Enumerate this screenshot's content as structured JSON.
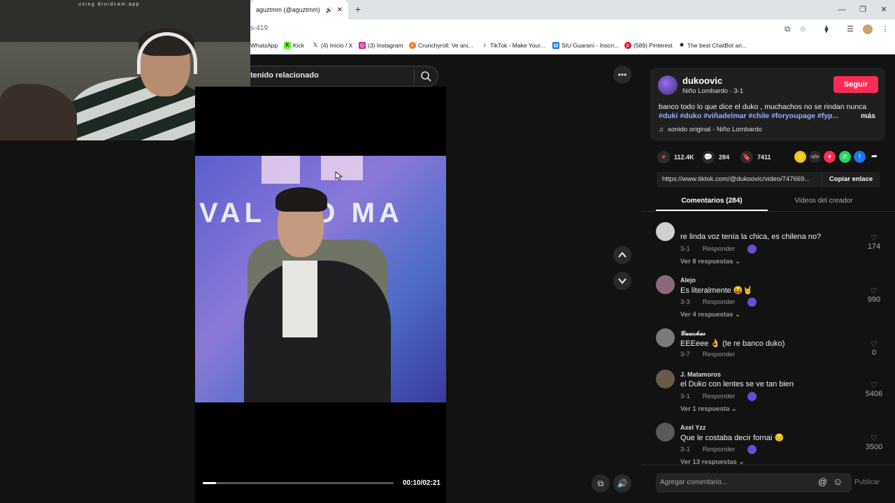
{
  "browser": {
    "tab_title": "aguztmm (@aguztmm) | Ti",
    "address": "s-419",
    "bookmarks": [
      {
        "label": "WhatsApp",
        "icon": "whatsapp-icon"
      },
      {
        "label": "Kick",
        "icon": "kick-icon"
      },
      {
        "label": "(4) Inicio / X",
        "icon": "x-icon"
      },
      {
        "label": "(3) Instagram",
        "icon": "instagram-icon"
      },
      {
        "label": "Crunchyroll: Ve ani...",
        "icon": "crunchyroll-icon"
      },
      {
        "label": "TikTok - Make Your...",
        "icon": "tiktok-icon"
      },
      {
        "label": "SIU Guaraní - Inscri...",
        "icon": "siu-icon"
      },
      {
        "label": "(589) Pinterest",
        "icon": "pinterest-icon"
      },
      {
        "label": "The best ChatBot an...",
        "icon": "chatgpt-icon"
      }
    ]
  },
  "webcam": {
    "label": "using droidcam.app"
  },
  "video": {
    "search_text": "tenido relacionado",
    "stage_text": "VAL    INO MA",
    "time": "00:10/02:21",
    "progress": 0.07
  },
  "creator": {
    "name": "dukoovic",
    "subtitle": "Niño Lombardo · 3-1",
    "follow_label": "Seguir",
    "description": "banco todo lo que dice el duko , muchachos no se rindan nunca",
    "tags": "#duki #duko #viñadelmar #chile #foryoupage #fyp...",
    "more_label": "más",
    "sound": "sonido original - Niño Lombardo"
  },
  "stats": {
    "likes": "112.4K",
    "comments": "284",
    "saves": "7411"
  },
  "link": {
    "url": "https://www.tiktok.com/@dukoovic/video/747669...",
    "copy_label": "Copiar enlace"
  },
  "tabs": {
    "comments": "Comentarios (284)",
    "creator_videos": "Videos del creador"
  },
  "comments": [
    {
      "user": "",
      "text": "re linda voz tenía la chica, es chilena no?",
      "date": "3-1",
      "reply": "Responder",
      "replies": "Ver 8 respuestas ⌄",
      "likes": "174",
      "avatar": "#cfcfcf"
    },
    {
      "user": "Alejo",
      "text": "Es literalmente 😝🤘",
      "date": "3-3",
      "reply": "Responder",
      "replies": "Ver 4 respuestas ⌄",
      "likes": "990",
      "avatar": "#8a6a7a"
    },
    {
      "user": "𝓖𝓾𝓪𝓬𝓱𝓪𝓼",
      "text": "EEEeee 👌 (te re banco duko)",
      "date": "3-7",
      "reply": "Responder",
      "replies": "",
      "likes": "0",
      "avatar": "#7a7a7a"
    },
    {
      "user": "J. Matamoros",
      "text": "el Duko con lentes se ve tan bien",
      "date": "3-1",
      "reply": "Responder",
      "replies": "Ver 1 respuesta ⌄",
      "likes": "5406",
      "avatar": "#6a5a4a"
    },
    {
      "user": "Axel Yzz",
      "text": "Que le costaba decir fornai 😔",
      "date": "3-1",
      "reply": "Responder",
      "replies": "Ver 13 respuestas ⌄",
      "likes": "3500",
      "avatar": "#5a5a5a"
    }
  ],
  "composer": {
    "placeholder": "Agregar comentario...",
    "publish": "Publicar"
  }
}
